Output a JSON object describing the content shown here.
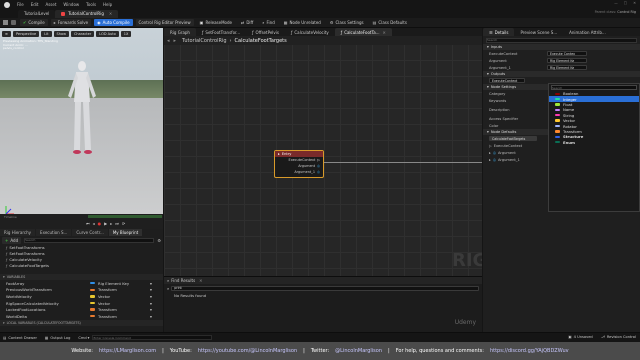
{
  "window": {
    "menu": [
      "File",
      "Edit",
      "Asset",
      "Window",
      "Tools",
      "Help"
    ],
    "tabs": [
      "TutorialLevel",
      "TutorialControlRig"
    ],
    "parent_class_label": "Parent class",
    "parent_class_value": "Control Rig"
  },
  "toolbar": {
    "compile": "Compile",
    "forwards_solve": "Forwards Solve",
    "auto_compile": "Auto Compile",
    "preview_scene": "Control Rig Editor Preview",
    "release_mode": "ReleaseMode",
    "diff": "Diff",
    "find": "Find",
    "node_unrelated": "Node Unrelated",
    "class_settings": "Class Settings",
    "class_defaults": "Class Defaults"
  },
  "viewport": {
    "perspective": "Perspective",
    "lit": "Lit",
    "show": "Show",
    "character": "Character",
    "lod_auto": "LOD Auto",
    "speed": "1X",
    "info_lines": [
      "Previewing Animation: TPS_Standing",
      "Current Anim: ...",
      "pelvis_control"
    ],
    "timeline_label": "Timeline"
  },
  "hierarchy": {
    "tabs": [
      "Rig Hierarchy",
      "Execution S...",
      "Curve Contr...",
      "My Blueprint"
    ],
    "add": "Add",
    "search_placeholder": "Search",
    "items": [
      "SetFootTransforms",
      "SetFootTransforms",
      "CalculateVelocity",
      "CalculateFootTargets"
    ]
  },
  "variables": {
    "header": "VARIABLES",
    "local_header": "LOCAL VARIABLES (CALCULATEFOOTTARGETS)",
    "rows": [
      {
        "name": "FootArray",
        "type": "Rig Element Key",
        "color": "#2f8fe8"
      },
      {
        "name": "PreviousWorldTransform",
        "type": "Transform",
        "color": "#e87a2f"
      },
      {
        "name": "WorldVelocity",
        "type": "Vector",
        "color": "#e8c72f"
      },
      {
        "name": "RigSpaceCalculatedVelocity",
        "type": "Vector",
        "color": "#e8c72f"
      },
      {
        "name": "LockedFootLocations",
        "type": "Transform",
        "color": "#e87a2f"
      },
      {
        "name": "WorldDelta",
        "type": "Transform",
        "color": "#e87a2f"
      }
    ]
  },
  "graph": {
    "tabs": [
      "Rig Graph",
      "SetFootTransfor...",
      "OffsetPelvis",
      "CalculateVelocity",
      "CalculateFootTa..."
    ],
    "breadcrumb_root": "TutorialControlRig",
    "breadcrumb_leaf": "CalculateFootTargets",
    "watermark": "RIG",
    "node": {
      "title": "Entry",
      "pins": [
        "ExecuteContext",
        "Argument",
        "Argument_1"
      ]
    }
  },
  "find_results": {
    "tab": "Find Results",
    "query": "print",
    "empty": "No Results found"
  },
  "details": {
    "tabs": [
      "Details",
      "Preview Scene S...",
      "Animation Attrib..."
    ],
    "search_placeholder": "Search",
    "inputs_header": "Inputs",
    "input_rows": [
      {
        "name": "ExecuteContext",
        "type": "Execute Contex"
      },
      {
        "name": "Argument",
        "type": "Rig Element Ke"
      },
      {
        "name": "Argument_1",
        "type": "Rig Element Ke"
      }
    ],
    "outputs_header": "Outputs",
    "output_rows": [
      "ExecuteContext"
    ],
    "settings_header": "Node Settings",
    "settings_rows": [
      "Category",
      "Keywords",
      "Description",
      "Access Specifier",
      "Color"
    ],
    "defaults_header": "Node Defaults",
    "defaults_rows": [
      "CalculateFootTargets",
      "ExecuteContext",
      "Argument",
      "Argument_1"
    ],
    "dropdown": {
      "search_placeholder": "Search",
      "items": [
        {
          "label": "Boolean",
          "color": "#8a0000"
        },
        {
          "label": "Integer",
          "color": "#1fe0a0",
          "selected": true
        },
        {
          "label": "Float",
          "color": "#9ee83a"
        },
        {
          "label": "Name",
          "color": "#c580ff"
        },
        {
          "label": "String",
          "color": "#ff3ab0"
        },
        {
          "label": "Vector",
          "color": "#ffc82f"
        },
        {
          "label": "Rotator",
          "color": "#9fb3ff"
        },
        {
          "label": "Transform",
          "color": "#ff8a2f"
        },
        {
          "label": "Structure",
          "color": "#2f5fe8"
        },
        {
          "label": "Enum",
          "color": "#0a6e55"
        }
      ]
    }
  },
  "statusbar": {
    "content_drawer": "Content Drawer",
    "output_log": "Output Log",
    "cmd": "Cmd",
    "console_placeholder": "Enter Console Command",
    "unsaved": "4 Unsaved",
    "revision_control": "Revision Control"
  },
  "footer": {
    "website_label": "Website:",
    "website": "https://LMarglison.com",
    "youtube_label": "YouTube:",
    "youtube": "https://youtube.com/@LincolnMarglison",
    "twitter_label": "Twitter:",
    "twitter": "@LincolnMarglison",
    "help_label": "For help, questions and comments:",
    "discord": "https://discord.gg/YAjQBDZWuv"
  },
  "watermark": "Udemy"
}
